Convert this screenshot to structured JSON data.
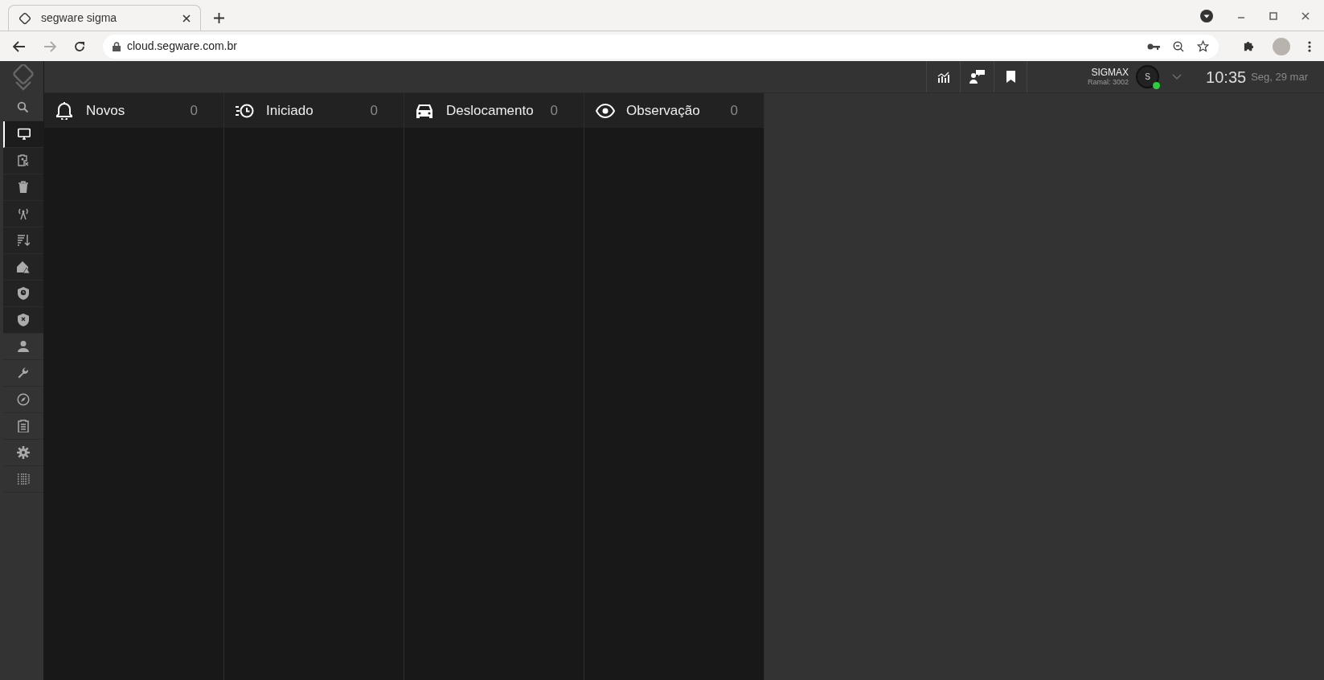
{
  "browser": {
    "tab_title": "segware sigma",
    "url": "cloud.segware.com.br"
  },
  "sidebar": {
    "items": [
      {
        "selected": false,
        "grouped": false
      },
      {
        "selected": true,
        "grouped": true
      },
      {
        "selected": false,
        "grouped": true
      },
      {
        "selected": false,
        "grouped": true
      },
      {
        "selected": false,
        "grouped": true
      },
      {
        "selected": false,
        "grouped": true
      },
      {
        "selected": false,
        "grouped": true
      },
      {
        "selected": false,
        "grouped": true
      },
      {
        "selected": false,
        "grouped": true
      },
      {
        "selected": false,
        "grouped": false
      },
      {
        "selected": false,
        "grouped": false
      },
      {
        "selected": false,
        "grouped": false
      },
      {
        "selected": false,
        "grouped": false
      },
      {
        "selected": false,
        "grouped": false
      },
      {
        "selected": false,
        "grouped": false
      }
    ]
  },
  "header": {
    "user": {
      "name": "SIGMAX",
      "extension": "Ramal: 3002",
      "avatar_letter": "S",
      "online": true
    },
    "time": "10:35",
    "date": "Seg, 29 mar"
  },
  "columns": [
    {
      "title": "Novos",
      "count": "0"
    },
    {
      "title": "Iniciado",
      "count": "0"
    },
    {
      "title": "Deslocamento",
      "count": "0"
    },
    {
      "title": "Observação",
      "count": "0"
    }
  ]
}
